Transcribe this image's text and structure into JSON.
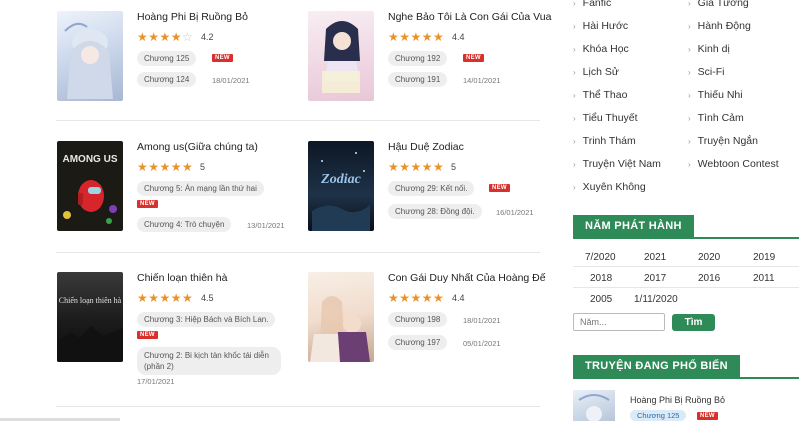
{
  "accent_color": "#2e8b57",
  "new_badge_color": "#d8302a",
  "star_color": "#e8932a",
  "stories": [
    {
      "title": "Hoàng Phi Bị Ruồng Bỏ",
      "rating": "4.2",
      "stars": 4,
      "chapters": [
        {
          "name": "Chương 125",
          "date": "",
          "is_new": true
        },
        {
          "name": "Chương 124",
          "date": "18/01/2021",
          "is_new": false
        }
      ]
    },
    {
      "title": "Nghe Bảo Tôi Là Con Gái Của Vua",
      "rating": "4.4",
      "stars": 5,
      "chapters": [
        {
          "name": "Chương 192",
          "date": "",
          "is_new": true
        },
        {
          "name": "Chương 191",
          "date": "14/01/2021",
          "is_new": false
        }
      ]
    },
    {
      "title": "Among us(Giữa chúng ta)",
      "rating": "5",
      "stars": 5,
      "chapters": [
        {
          "name": "Chương 5: Án mạng lần thứ hai",
          "date": "",
          "is_new": true
        },
        {
          "name": "Chương 4: Trò chuyện",
          "date": "13/01/2021",
          "is_new": false
        }
      ]
    },
    {
      "title": "Hậu Duệ Zodiac",
      "rating": "5",
      "stars": 5,
      "chapters": [
        {
          "name": "Chương 29: Kết nối.",
          "date": "",
          "is_new": true
        },
        {
          "name": "Chương 28: Đồng đội.",
          "date": "16/01/2021",
          "is_new": false
        }
      ]
    },
    {
      "title": "Chiến loạn thiên hà",
      "rating": "4.5",
      "stars": 5,
      "chapters": [
        {
          "name": "Chương 3: Hiệp Bách và Bích Lan.",
          "date": "",
          "is_new": true
        },
        {
          "name": "Chương 2: Bi kịch tàn khốc tái diễn (phần 2)",
          "date": "17/01/2021",
          "is_new": false
        }
      ]
    },
    {
      "title": "Con Gái Duy Nhất Của Hoàng Đế",
      "rating": "4.4",
      "stars": 5,
      "chapters": [
        {
          "name": "Chương 198",
          "date": "18/01/2021",
          "is_new": false
        },
        {
          "name": "Chương 197",
          "date": "05/01/2021",
          "is_new": false
        }
      ]
    }
  ],
  "covers": {
    "among_us": "AMONG US",
    "zodiac": "Zodiac",
    "chien_loan": "Chiến loạn thiên hà"
  },
  "genres": [
    "Fanfic",
    "Gia Tướng",
    "Hài Hước",
    "Hành Động",
    "Khóa Học",
    "Kinh dị",
    "Lịch Sử",
    "Sci-Fi",
    "Thể Thao",
    "Thiếu Nhi",
    "Tiểu Thuyết",
    "Tình Cảm",
    "Trinh Thám",
    "Truyện Ngắn",
    "Truyện Việt Nam",
    "Webtoon Contest",
    "Xuyên Không"
  ],
  "year_section": {
    "title": "NĂM PHÁT HÀNH",
    "years": [
      "7/2020",
      "2021",
      "2020",
      "2019",
      "2018",
      "2017",
      "2016",
      "2011",
      "2005",
      "1/11/2020"
    ],
    "input_placeholder": "Năm...",
    "search_button": "Tìm"
  },
  "popular_section": {
    "title": "TRUYỆN ĐANG PHỔ BIẾN",
    "item_title": "Hoàng Phi Bị Ruồng Bỏ",
    "item_chapter": "Chương 125"
  },
  "new_label": "NEW"
}
